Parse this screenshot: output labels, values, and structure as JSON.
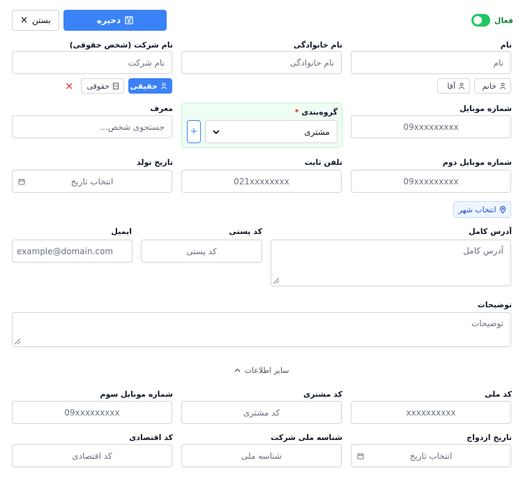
{
  "toolbar": {
    "save_label": "ذخیره",
    "close_label": "بستن",
    "active_label": "فعال",
    "active": true
  },
  "fields": {
    "first_name": {
      "label": "نام",
      "placeholder": "نام"
    },
    "last_name": {
      "label": "نام خانوادگی",
      "placeholder": "نام خانوادگی"
    },
    "company": {
      "label": "نام شرکت (شخص حقوقی)",
      "placeholder": "نام شرکت"
    },
    "mobile": {
      "label": "شماره موبایل",
      "placeholder": "09xxxxxxxxx"
    },
    "group": {
      "label": "گروه‌بندی",
      "required_mark": "*",
      "value": "مشتری",
      "add_label": "+"
    },
    "referrer": {
      "label": "معرف",
      "placeholder": "جستجوی شخص..."
    },
    "mobile2": {
      "label": "شماره موبایل دوم",
      "placeholder": "09xxxxxxxxx"
    },
    "phone": {
      "label": "تلفن ثابت",
      "placeholder": "021xxxxxxxx"
    },
    "birth_date": {
      "label": "تاریخ تولد",
      "placeholder": "انتخاب تاریخ"
    },
    "address": {
      "label": "آدرس کامل",
      "placeholder": "آدرس کامل"
    },
    "postal_code": {
      "label": "کد پستی",
      "placeholder": "کد پستی"
    },
    "email": {
      "label": "ایمیل",
      "placeholder": "example@domain.com"
    },
    "description": {
      "label": "توضیحات",
      "placeholder": "توضیحات"
    },
    "national_code": {
      "label": "کد ملی",
      "placeholder": "xxxxxxxxxx"
    },
    "customer_code": {
      "label": "کد مشتری",
      "placeholder": "کد مشتری"
    },
    "mobile3": {
      "label": "شماره موبایل سوم",
      "placeholder": "09xxxxxxxxx"
    },
    "marriage_date": {
      "label": "تاریخ ازدواج",
      "placeholder": "انتخاب تاریخ"
    },
    "company_national_id": {
      "label": "شناسه ملی شرکت",
      "placeholder": "شناسه ملی"
    },
    "economic_code": {
      "label": "کد اقتصادی",
      "placeholder": "کد اقتصادی"
    }
  },
  "gender": {
    "female": "خانم",
    "male": "آقا"
  },
  "person_type": {
    "real": "حقیقی",
    "legal": "حقوقی",
    "clear": "×"
  },
  "city_button": "انتخاب شهر",
  "other_info": "سایر اطلاعات",
  "colors": {
    "primary": "#3b82f6",
    "active_green": "#22c55e",
    "group_bg": "#f0fdf4"
  }
}
